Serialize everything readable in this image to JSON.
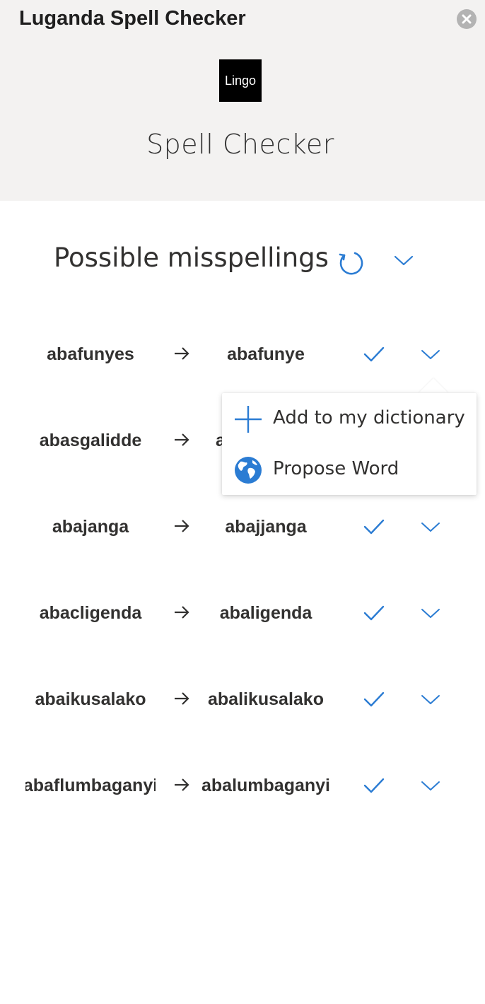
{
  "header": {
    "app_title": "Luganda Spell Checker",
    "logo_text": "Lingo",
    "heading": "Spell Checker"
  },
  "section": {
    "title": "Possible misspellings"
  },
  "suggestions": [
    {
      "wrong": "abafunyes",
      "correct": "abafunye"
    },
    {
      "wrong": "abasgalidde",
      "correct": "a"
    },
    {
      "wrong": "abajanga",
      "correct": "abajjanga"
    },
    {
      "wrong": "abacligenda",
      "correct": "abaligenda"
    },
    {
      "wrong": "abaikusalako",
      "correct": "abalikusalako"
    },
    {
      "wrong": "abaflumbaganyi",
      "correct": "abalumbaganyi"
    }
  ],
  "popup_menu": {
    "items": [
      {
        "label": "Add to my dictionary",
        "icon": "plus-icon"
      },
      {
        "label": "Propose Word",
        "icon": "globe-icon"
      }
    ]
  },
  "colors": {
    "accent": "#2b7cd3",
    "header_bg": "#f3f2f1",
    "text": "#323130"
  }
}
